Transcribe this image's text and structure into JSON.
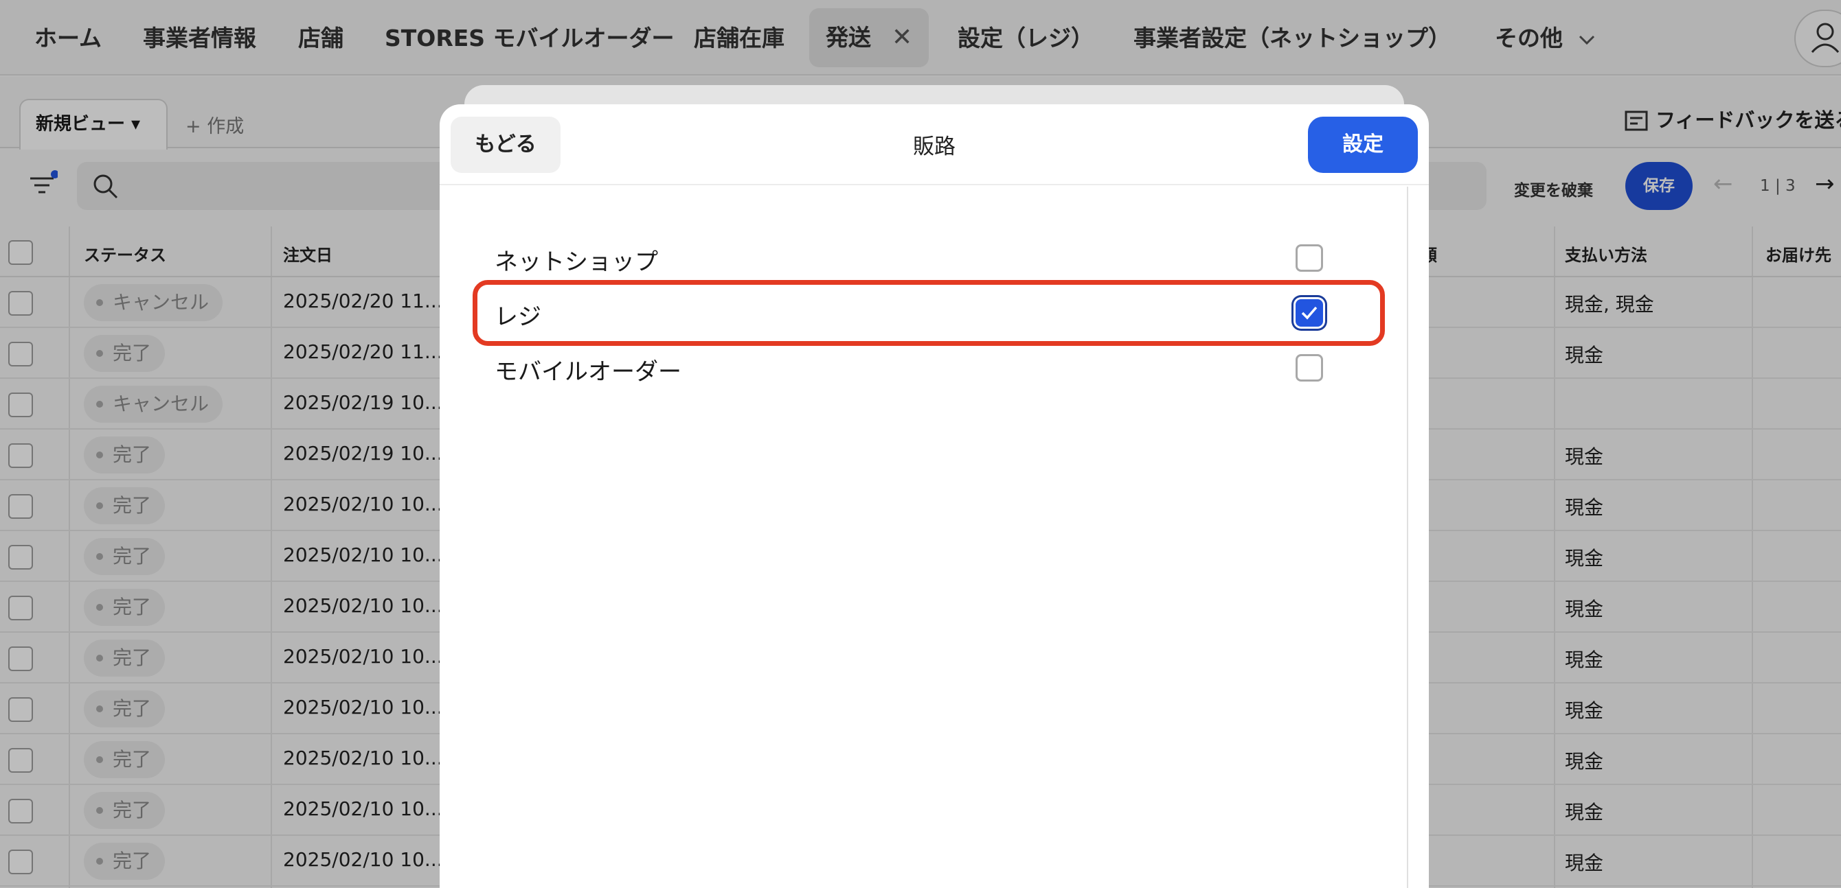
{
  "nav": {
    "items": [
      "ホーム",
      "事業者情報",
      "店舗",
      "STORES モバイルオーダー",
      "店舗在庫",
      "発送",
      "設定（レジ）",
      "事業者設定（ネットショップ）",
      "その他"
    ],
    "active_index": 5
  },
  "viewbar": {
    "view_tab": "新規ビュー ▾",
    "create": "+ 作成",
    "feedback": "フィードバックを送る"
  },
  "toolbar": {
    "discard": "変更を破棄",
    "save": "保存",
    "pager": "1 | 3"
  },
  "table": {
    "headers": [
      "ステータス",
      "注文日",
      "支払い方法",
      "お届け先"
    ],
    "partial_header": "額",
    "rows": [
      {
        "status": "キャンセル",
        "date": "2025/02/20 11...",
        "payment": "現金, 現金"
      },
      {
        "status": "完了",
        "date": "2025/02/20 11...",
        "payment": "現金"
      },
      {
        "status": "キャンセル",
        "date": "2025/02/19 10...",
        "payment": ""
      },
      {
        "status": "完了",
        "date": "2025/02/19 10...",
        "payment": "現金"
      },
      {
        "status": "完了",
        "date": "2025/02/10 10...",
        "payment": "現金"
      },
      {
        "status": "完了",
        "date": "2025/02/10 10...",
        "payment": "現金"
      },
      {
        "status": "完了",
        "date": "2025/02/10 10...",
        "payment": "現金"
      },
      {
        "status": "完了",
        "date": "2025/02/10 10...",
        "payment": "現金"
      },
      {
        "status": "完了",
        "date": "2025/02/10 10...",
        "payment": "現金"
      },
      {
        "status": "完了",
        "date": "2025/02/10 10...",
        "payment": "現金"
      },
      {
        "status": "完了",
        "date": "2025/02/10 10...",
        "payment": "現金"
      },
      {
        "status": "完了",
        "date": "2025/02/10 10...",
        "payment": "現金"
      }
    ]
  },
  "modal": {
    "back": "もどる",
    "title": "販路",
    "set": "設定",
    "options": [
      {
        "label": "ネットショップ",
        "checked": false
      },
      {
        "label": "レジ",
        "checked": true
      },
      {
        "label": "モバイルオーダー",
        "checked": false
      }
    ]
  },
  "colors": {
    "accent": "#2760e6",
    "highlight": "#e33a22"
  }
}
